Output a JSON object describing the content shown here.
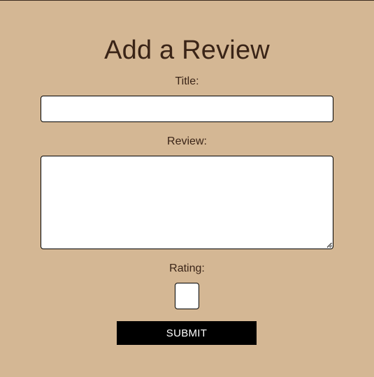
{
  "form": {
    "heading": "Add a Review",
    "title_label": "Title:",
    "title_value": "",
    "review_label": "Review:",
    "review_value": "",
    "rating_label": "Rating:",
    "rating_value": "",
    "submit_label": "SUBMIT"
  },
  "colors": {
    "background": "#d4b794",
    "text": "#3a2417",
    "button_bg": "#000000",
    "button_text": "#ffffff",
    "field_bg": "#ffffff"
  }
}
